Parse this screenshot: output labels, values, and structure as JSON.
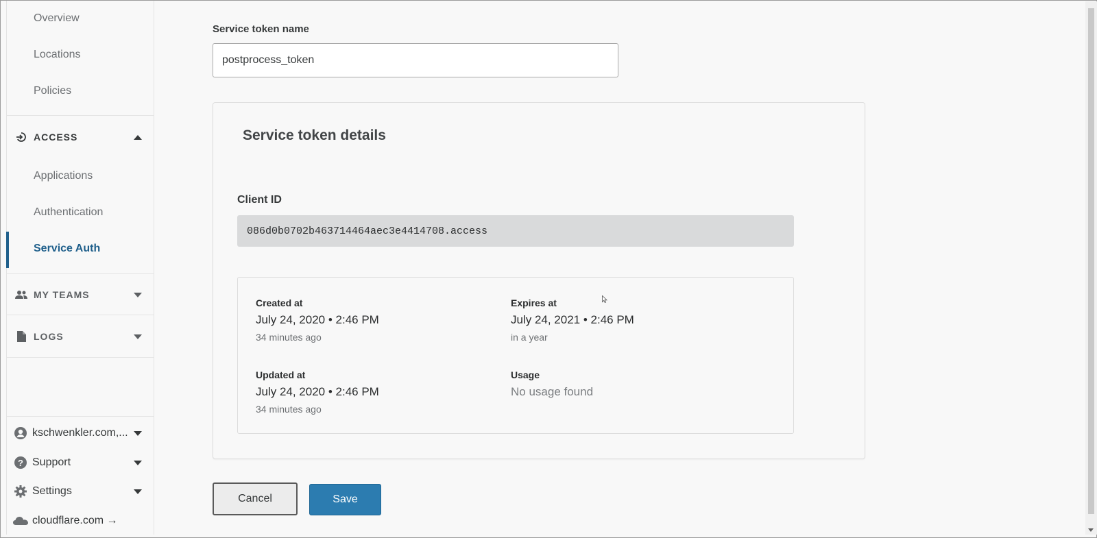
{
  "sidebar": {
    "top_items": [
      {
        "label": "Overview"
      },
      {
        "label": "Locations"
      },
      {
        "label": "Policies"
      }
    ],
    "access": {
      "label": "ACCESS",
      "items": [
        {
          "label": "Applications"
        },
        {
          "label": "Authentication"
        },
        {
          "label": "Service Auth"
        }
      ]
    },
    "my_teams": {
      "label": "MY TEAMS"
    },
    "logs": {
      "label": "LOGS"
    },
    "bottom": {
      "account": "kschwenkler.com,...",
      "support": "Support",
      "settings": "Settings",
      "cloudflare": "cloudflare.com →"
    }
  },
  "form": {
    "name_label": "Service token name",
    "name_value": "postprocess_token"
  },
  "details": {
    "title": "Service token details",
    "client_id_label": "Client ID",
    "client_id": "086d0b0702b463714464aec3e4414708.access",
    "created": {
      "label": "Created at",
      "value": "July 24, 2020 • 2:46 PM",
      "relative": "34 minutes ago"
    },
    "expires": {
      "label": "Expires at",
      "value": "July 24, 2021 • 2:46 PM",
      "relative": "in a year"
    },
    "updated": {
      "label": "Updated at",
      "value": "July 24, 2020 • 2:46 PM",
      "relative": "34 minutes ago"
    },
    "usage": {
      "label": "Usage",
      "value": "No usage found"
    }
  },
  "actions": {
    "cancel": "Cancel",
    "save": "Save"
  },
  "colors": {
    "accent": "#1f5f8b",
    "primary_button": "#2c7cb0"
  }
}
